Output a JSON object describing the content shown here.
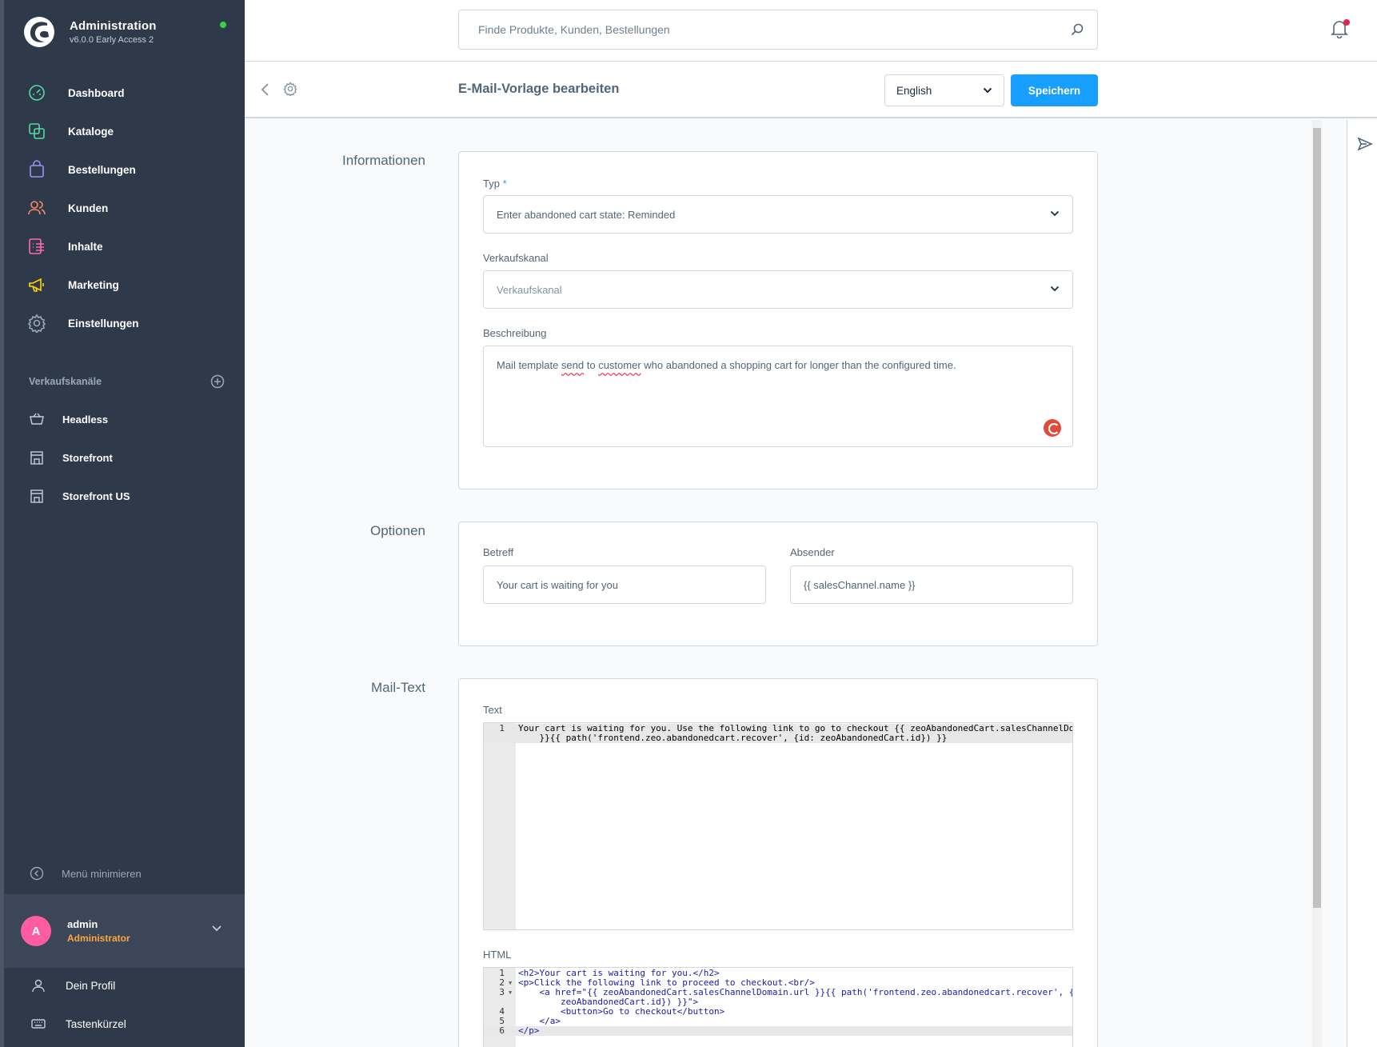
{
  "app": {
    "title": "Administration",
    "version": "v6.0.0 Early Access 2"
  },
  "nav": {
    "items": [
      {
        "label": "Dashboard",
        "icon": "dashboard-icon",
        "color": "#57d9a3"
      },
      {
        "label": "Kataloge",
        "icon": "products-icon",
        "color": "#57d9a3"
      },
      {
        "label": "Bestellungen",
        "icon": "shopping-bag-icon",
        "color": "#a092f0"
      },
      {
        "label": "Kunden",
        "icon": "customers-icon",
        "color": "#f88962"
      },
      {
        "label": "Inhalte",
        "icon": "content-icon",
        "color": "#ff68b4"
      },
      {
        "label": "Marketing",
        "icon": "megaphone-icon",
        "color": "#ffd700"
      },
      {
        "label": "Einstellungen",
        "icon": "gear-icon",
        "color": "#9aa8b5"
      }
    ]
  },
  "sales_channels": {
    "title": "Verkaufskanäle",
    "items": [
      {
        "label": "Headless",
        "icon": "basket-icon"
      },
      {
        "label": "Storefront",
        "icon": "storefront-icon"
      },
      {
        "label": "Storefront US",
        "icon": "storefront-icon"
      }
    ]
  },
  "collapse_label": "Menü minimieren",
  "user": {
    "initial": "A",
    "name": "admin",
    "role": "Administrator"
  },
  "user_menu": {
    "profile": "Dein Profil",
    "shortcuts": "Tastenkürzel"
  },
  "search": {
    "placeholder": "Finde Produkte, Kunden, Bestellungen"
  },
  "smartbar": {
    "title": "E-Mail-Vorlage bearbeiten",
    "language": "English",
    "save_label": "Speichern"
  },
  "info_section": {
    "title": "Informationen",
    "type_label": "Typ",
    "type_required": "*",
    "type_value": "Enter abandoned cart state: Reminded",
    "channel_label": "Verkaufskanal",
    "channel_placeholder": "Verkaufskanal",
    "description_label": "Beschreibung",
    "description_parts": [
      "Mail template ",
      "send",
      " to ",
      "customer",
      " who abandoned a shopping cart for longer than the configured time."
    ]
  },
  "options_section": {
    "title": "Optionen",
    "subject_label": "Betreff",
    "subject_value": "Your cart is waiting for you",
    "sender_label": "Absender",
    "sender_value": "{{ salesChannel.name }}"
  },
  "mail_section": {
    "title": "Mail-Text",
    "text_label": "Text",
    "text_lines": [
      {
        "num": "1",
        "code": "Your cart is waiting for you. Use the following link to go to checkout {{ zeoAbandonedCart.salesChannelDomain.url"
      },
      {
        "num": "",
        "code": "    }}{{ path('frontend.zeo.abandonedcart.recover', {id: zeoAbandonedCart.id}) }}"
      }
    ],
    "html_label": "HTML",
    "html_lines": [
      {
        "num": "1",
        "fold": "",
        "code": "<h2>Your cart is waiting for you.</h2>"
      },
      {
        "num": "2",
        "fold": "▼",
        "code": "<p>Click the following link to proceed to checkout.<br/>"
      },
      {
        "num": "3",
        "fold": "▼",
        "code": "    <a href=\"{{ zeoAbandonedCart.salesChannelDomain.url }}{{ path('frontend.zeo.abandonedcart.recover', {id:"
      },
      {
        "num": "",
        "fold": "",
        "code": "        zeoAbandonedCart.id}) }}\">"
      },
      {
        "num": "4",
        "fold": "",
        "code": "        <button>Go to checkout</button>"
      },
      {
        "num": "5",
        "fold": "",
        "code": "    </a>"
      },
      {
        "num": "6",
        "fold": "",
        "code": "</p>"
      }
    ]
  },
  "colors": {
    "sidebar": "#2e3a4a",
    "accent": "#189eff",
    "online": "#37d046",
    "notification": "#de294c",
    "avatar": "#ff5ca1",
    "role": "#ffa63a"
  }
}
